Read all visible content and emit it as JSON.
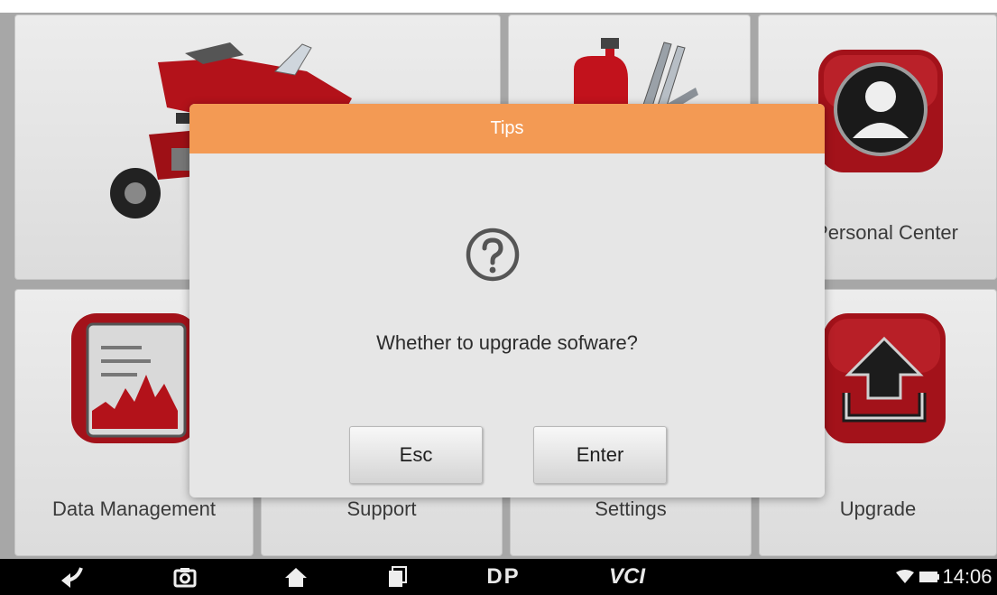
{
  "tiles": {
    "top_left_label": "",
    "top_middle_label": "",
    "personal_center": "Personal Center",
    "data_management": "Data Management",
    "support": "Support",
    "settings": "Settings",
    "upgrade": "Upgrade"
  },
  "dialog": {
    "title": "Tips",
    "message": "Whether to upgrade sofware?",
    "icon": "question-circle-icon",
    "esc_label": "Esc",
    "enter_label": "Enter",
    "header_color": "#f39a54"
  },
  "navbar": {
    "dp_label": "DP",
    "vci_label": "VCI",
    "time": "14:06",
    "icons": [
      "back-icon",
      "camera-icon",
      "home-icon",
      "recent-apps-icon",
      "wifi-icon",
      "battery-icon"
    ]
  },
  "colors": {
    "accent": "#f39a54",
    "icon_red": "#b3121a",
    "navbar": "#000000"
  }
}
